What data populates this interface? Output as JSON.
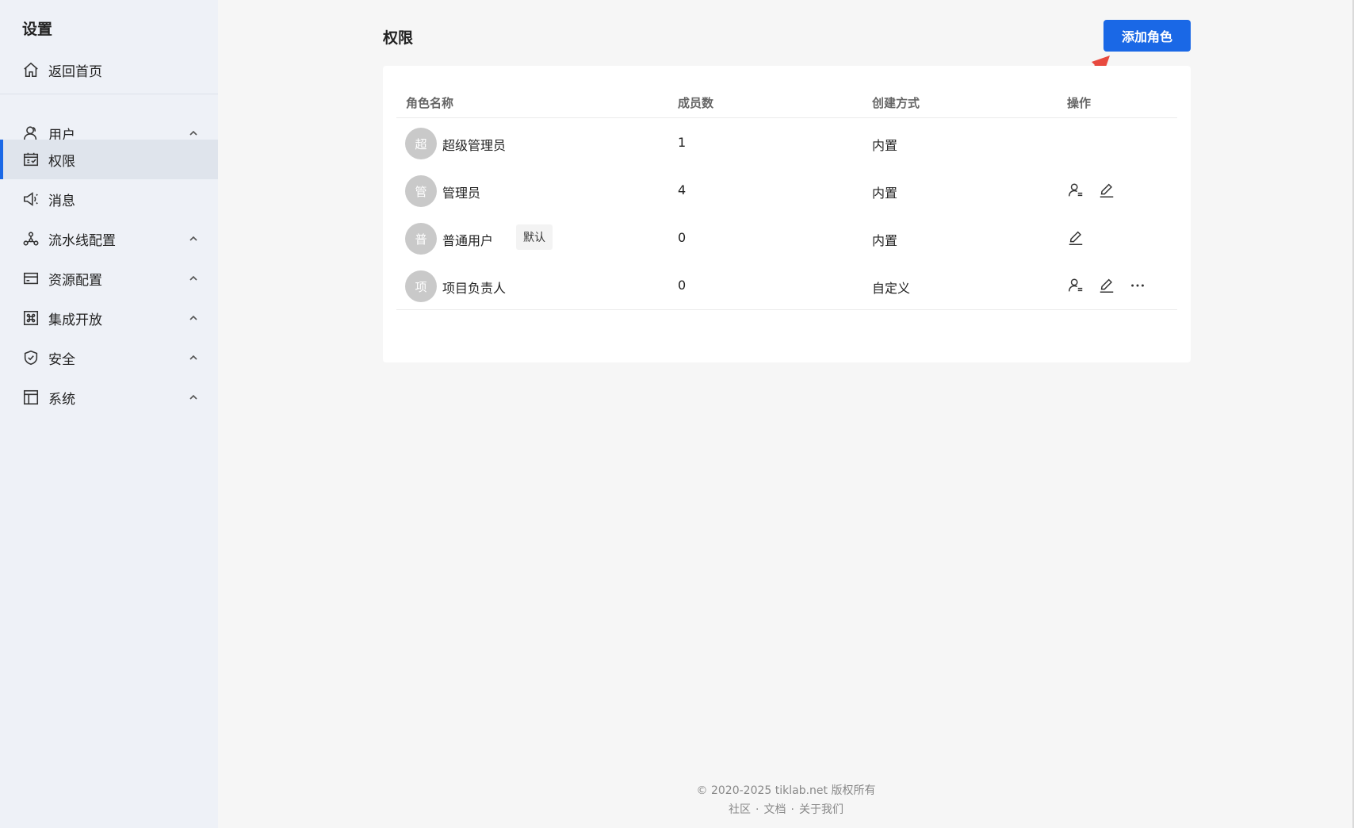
{
  "sidebar": {
    "title": "设置",
    "home": {
      "label": "返回首页",
      "icon": "home-icon"
    },
    "items": [
      {
        "label": "用户",
        "icon": "user-icon",
        "expandable": true
      },
      {
        "label": "权限",
        "icon": "calendar-check-icon",
        "active": true
      },
      {
        "label": "消息",
        "icon": "megaphone-icon"
      },
      {
        "label": "流水线配置",
        "icon": "network-icon",
        "expandable": true
      },
      {
        "label": "资源配置",
        "icon": "card-icon",
        "expandable": true
      },
      {
        "label": "集成开放",
        "icon": "command-icon",
        "expandable": true
      },
      {
        "label": "安全",
        "icon": "shield-check-icon",
        "expandable": true
      },
      {
        "label": "系统",
        "icon": "layout-icon",
        "expandable": true
      }
    ]
  },
  "header": {
    "title": "权限",
    "add_button": "添加角色"
  },
  "table": {
    "columns": [
      "角色名称",
      "成员数",
      "创建方式",
      "操作"
    ],
    "rows": [
      {
        "avatar": "超",
        "name": "超级管理员",
        "members": "1",
        "type": "内置",
        "tag": "",
        "actions": []
      },
      {
        "avatar": "管",
        "name": "管理员",
        "members": "4",
        "type": "内置",
        "tag": "",
        "actions": [
          "user-settings-icon",
          "edit-icon"
        ]
      },
      {
        "avatar": "普",
        "name": "普通用户",
        "members": "0",
        "type": "内置",
        "tag": "默认",
        "actions": [
          "edit-icon"
        ]
      },
      {
        "avatar": "项",
        "name": "项目负责人",
        "members": "0",
        "type": "自定义",
        "tag": "",
        "actions": [
          "user-settings-icon",
          "edit-icon",
          "more-icon"
        ]
      }
    ]
  },
  "footer": {
    "copyright": "© 2020-2025 tiklab.net 版权所有",
    "links": [
      "社区",
      "文档",
      "关于我们"
    ],
    "separator": "·"
  },
  "colors": {
    "accent": "#1a68e6",
    "sidebar_bg": "#eef1f7",
    "annotation": "#e84a3f"
  }
}
